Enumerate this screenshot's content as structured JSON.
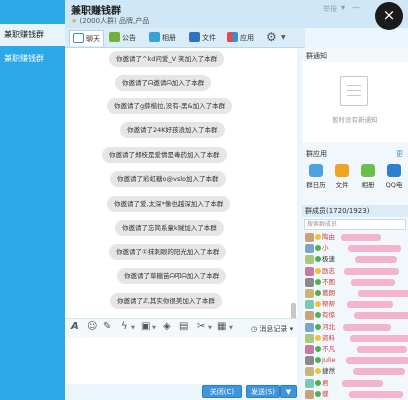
{
  "sidebar": {
    "items": [
      {
        "label": "兼职赚钱群"
      },
      {
        "label": "兼职赚钱群"
      }
    ]
  },
  "header": {
    "title": "兼职赚钱群",
    "member_count": "(2000人群)",
    "category": "品牌,产品",
    "report": "举报",
    "close_icon": "×"
  },
  "tabs": [
    {
      "label": "聊天",
      "icon": "chat-bubble-icon"
    },
    {
      "label": "公告",
      "icon": "announcement-icon"
    },
    {
      "label": "相册",
      "icon": "photo-icon"
    },
    {
      "label": "文件",
      "icon": "folder-icon"
    },
    {
      "label": "应用",
      "icon": "apps-icon"
    }
  ],
  "messages": [
    "你邀请了^kd问爱_V 笑加入了本群",
    "你邀请了ᗣ邀请ᗣ加入了本群",
    "你邀请了g薛楷拉,没有-黑&加入了本群",
    "你邀请了24K好孩浪加入了本群",
    "你邀请了郑枝是爱情是毒药加入了本群",
    "你邀请了彩虹糖o@vslo加入了本群",
    "你邀请了爱,太深*像也越深加入了本群",
    "你邀请了忘简系童k贼加入了本群",
    "你邀请了①抹刺眼的阳光加入了本群",
    "你邀请了草糖苗ᗣ叩ᗣ加入了本群",
    "你邀请了ℤ,其实你很美加入了本群"
  ],
  "toolbar": {
    "history_label": "消息记录"
  },
  "buttons": {
    "close_label": "关闭(C)",
    "send_label": "发送(S)"
  },
  "right_panel": {
    "notice_title": "群通知",
    "notice_empty": "暂时没有新通知",
    "apps_title": "群应用",
    "apps_more": "更",
    "apps": [
      {
        "label": "群日历",
        "color": "#4aa3df"
      },
      {
        "label": "文件",
        "color": "#f0a31e"
      },
      {
        "label": "相册",
        "color": "#6cbf4a"
      },
      {
        "label": "QQ电",
        "color": "#2d7fd0"
      }
    ],
    "members_title": "群成员(1720/1923)",
    "search_placeholder": "搜索群成员",
    "members": [
      {
        "name": "陶由",
        "color": "#d43b3b"
      },
      {
        "name": "小",
        "color": "#d43b3b"
      },
      {
        "name": "极速",
        "color": "#333333"
      },
      {
        "name": "励志",
        "color": "#d43b3b"
      },
      {
        "name": "不图",
        "color": "#d43b3b"
      },
      {
        "name": "葛朗",
        "color": "#d43b3b"
      },
      {
        "name": "帮帮",
        "color": "#d43b3b"
      },
      {
        "name": "有惊",
        "color": "#d43b3b"
      },
      {
        "name": "河北",
        "color": "#d43b3b"
      },
      {
        "name": "资料",
        "color": "#d43b3b"
      },
      {
        "name": "不凡",
        "color": "#d43b3b"
      },
      {
        "name": "Julie",
        "color": "#d43b3b"
      },
      {
        "name": "捷然",
        "color": "#333333"
      },
      {
        "name": "君",
        "color": "#d43b3b"
      },
      {
        "name": "蝶",
        "color": "#d43b3b"
      }
    ]
  }
}
